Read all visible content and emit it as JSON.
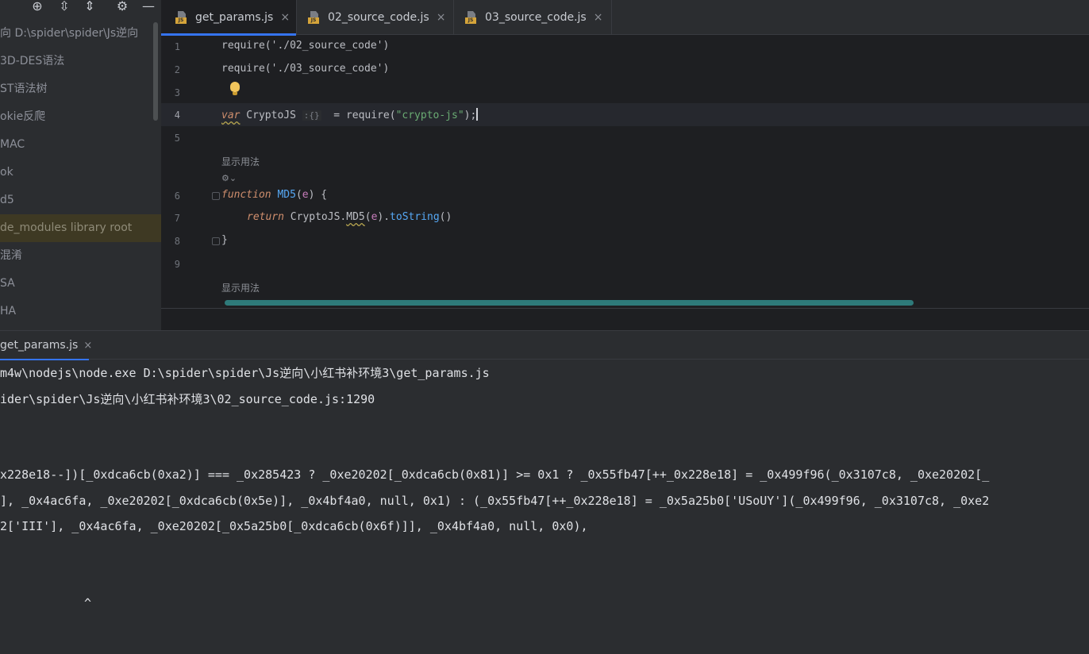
{
  "project_panel": {
    "toolbar": {
      "icon_0": "⊕",
      "icon_1": "⇳",
      "icon_2": "⇕",
      "icon_3": "⚙",
      "icon_4": "—"
    },
    "tree": [
      "向  D:\\spider\\spider\\Js逆向",
      "3D-DES语法",
      "ST语法树",
      "okie反爬",
      "MAC",
      "ok",
      "d5",
      "de_modules  library root",
      "混淆",
      "SA",
      "HA"
    ]
  },
  "editor": {
    "tabs": [
      {
        "label": "get_params.js",
        "badge": "JS",
        "close": "×"
      },
      {
        "label": "02_source_code.js",
        "badge": "JS",
        "close": "×"
      },
      {
        "label": "03_source_code.js",
        "badge": "JS",
        "close": "×"
      }
    ],
    "line_numbers": [
      "1",
      "2",
      "3",
      "4",
      "5",
      "6",
      "7",
      "8",
      "9"
    ],
    "code": {
      "l1": "require('./02_source_code')",
      "l2": "require('./03_source_code')",
      "l4_kw": "var",
      "l4_name": " CryptoJS ",
      "l4_inlay": ":{}",
      "l4_eq": "  = require(",
      "l4_str": "\"crypto-js\"",
      "l4_end": ");",
      "l6_kw": "function",
      "l6_fn": " MD5",
      "l6_open": "(",
      "l6_param": "e",
      "l6_close": ") {",
      "l7_kw": "return",
      "l7_obj": " CryptoJS.",
      "l7_fn": "MD5",
      "l7_open": "(",
      "l7_param": "e",
      "l7_call": ").",
      "l7_method": "toString",
      "l7_end": "()",
      "l8": "}"
    },
    "usage_hint_1": "显示用法",
    "usage_hint_2": "显示用法",
    "ai_icon": "⚙⌄"
  },
  "run_panel": {
    "tab": {
      "label": "get_params.js",
      "close": "×"
    },
    "output": [
      "m4w\\nodejs\\node.exe D:\\spider\\spider\\Js逆向\\小红书补环境3\\get_params.js",
      "ider\\spider\\Js逆向\\小红书补环境3\\02_source_code.js:1290",
      "x228e18--])[_0xdca6cb(0xa2)] === _0x285423 ? _0xe20202[_0xdca6cb(0x81)] >= 0x1 ? _0x55fb47[++_0x228e18] = _0x499f96(_0x3107c8, _0xe20202[_",
      "], _0x4ac6fa, _0xe20202[_0xdca6cb(0x5e)], _0x4bf4a0, null, 0x1) : (_0x55fb47[++_0x228e18] = _0x5a25b0['USoUY'](_0x499f96, _0x3107c8, _0xe2",
      "2['III'], _0x4ac6fa, _0xe20202[_0x5a25b0[_0xdca6cb(0x6f)]], _0x4bf4a0, null, 0x0),",
      "^"
    ]
  },
  "colors": {
    "accent": "#3574f0",
    "keyword": "#cf8e6d",
    "string": "#6aab73",
    "function": "#56a8f5",
    "parameter": "#c77dbb"
  }
}
